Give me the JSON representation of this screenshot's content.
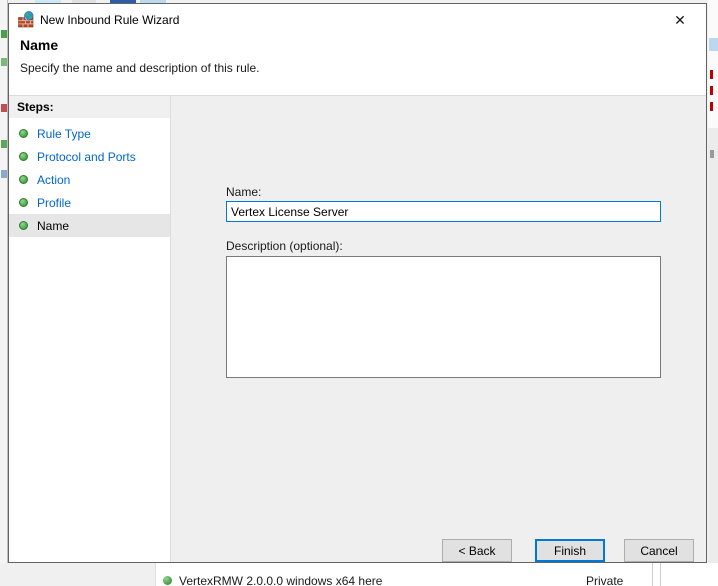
{
  "window": {
    "title": "New Inbound Rule Wizard",
    "close": "✕"
  },
  "header": {
    "title": "Name",
    "subtitle": "Specify the name and description of this rule."
  },
  "steps": {
    "heading": "Steps:",
    "items": [
      {
        "label": "Rule Type",
        "current": false
      },
      {
        "label": "Protocol and Ports",
        "current": false
      },
      {
        "label": "Action",
        "current": false
      },
      {
        "label": "Profile",
        "current": false
      },
      {
        "label": "Name",
        "current": true
      }
    ]
  },
  "form": {
    "name_label": "Name:",
    "name_value": "Vertex License Server",
    "description_label": "Description (optional):",
    "description_value": ""
  },
  "footer": {
    "back": "< Back",
    "finish": "Finish",
    "cancel": "Cancel"
  },
  "background_window": {
    "list_row_text": "VertexRMW 2.0.0.0 windows x64 here",
    "profile_cell": "Private"
  },
  "colors": {
    "accent": "#0078d7",
    "step_link": "#0066cc",
    "step_bullet_green": "#2d8f2d",
    "dialog_border": "#646464",
    "content_bg": "#efefef"
  }
}
